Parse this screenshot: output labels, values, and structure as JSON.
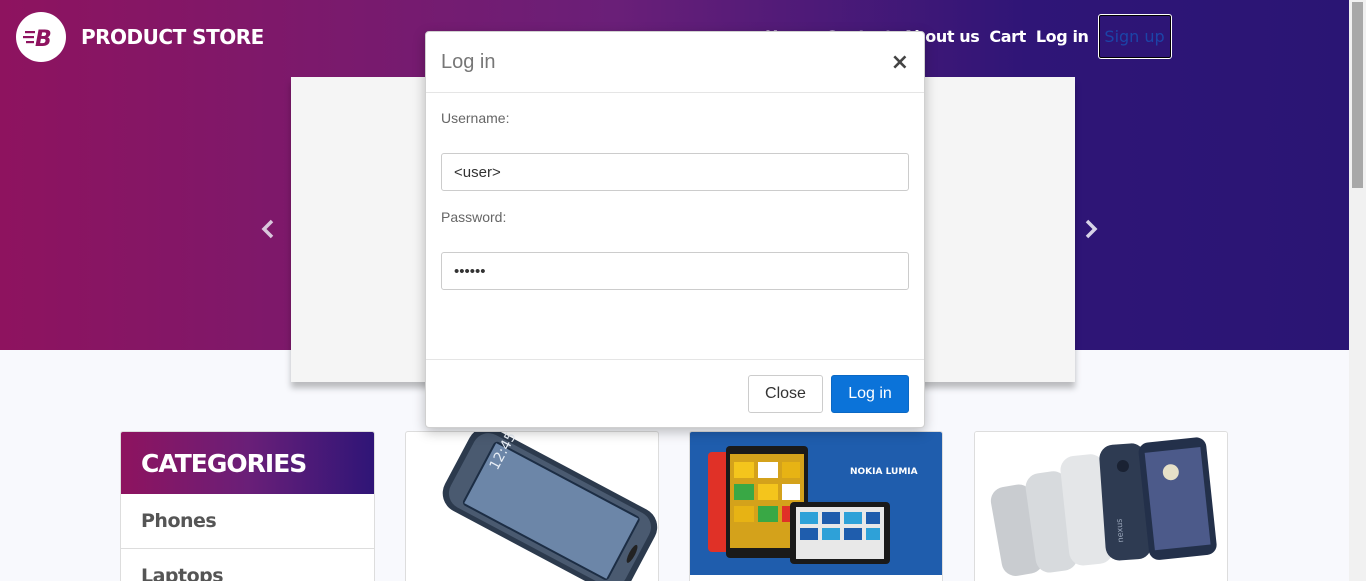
{
  "brand": {
    "name": "PRODUCT STORE",
    "logo_letter": "B"
  },
  "nav": {
    "items": [
      "Home",
      "Contact",
      "About us",
      "Cart",
      "Log in"
    ],
    "signup": "Sign up"
  },
  "modal": {
    "title": "Log in",
    "close_symbol": "×",
    "username_label": "Username:",
    "username_value": "<user>",
    "password_label": "Password:",
    "password_value": "••••••",
    "close_button": "Close",
    "login_button": "Log in"
  },
  "categories": {
    "title": "CATEGORIES",
    "items": [
      "Phones",
      "Laptops"
    ]
  },
  "products": [
    {
      "image": "samsung-phone"
    },
    {
      "image": "nokia-lumia",
      "banner_text": "NOKIA LUMIA"
    },
    {
      "image": "nexus-phones"
    }
  ],
  "colors": {
    "gradient_start": "#8e135f",
    "gradient_end": "#2a1574",
    "login_blue": "#0b73d9"
  }
}
